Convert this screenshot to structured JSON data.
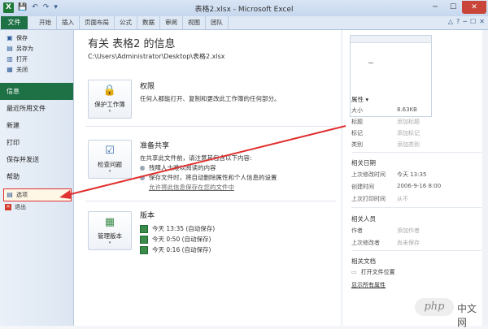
{
  "titlebar": {
    "title": "表格2.xlsx - Microsoft Excel",
    "app_glyph": "X",
    "qat": [
      "💾",
      "↶",
      "↷",
      "▾"
    ],
    "controls": [
      "─",
      "☐",
      "✕"
    ]
  },
  "ribbon": {
    "file_tab": "文件",
    "tabs": [
      "开始",
      "插入",
      "页面布局",
      "公式",
      "数据",
      "审阅",
      "视图",
      "团队"
    ],
    "right_icons": [
      "△",
      "?",
      "─",
      "☐",
      "✕"
    ]
  },
  "nav": {
    "small": [
      {
        "label": "保存",
        "icon": "save-icon",
        "glyph": "▣"
      },
      {
        "label": "另存为",
        "icon": "save-as-icon",
        "glyph": "▤"
      },
      {
        "label": "打开",
        "icon": "folder-icon",
        "glyph": "▥"
      },
      {
        "label": "关闭",
        "icon": "close-file-icon",
        "glyph": "▦"
      }
    ],
    "big": [
      "信息",
      "最近所用文件",
      "新建",
      "打印",
      "保存并发送",
      "帮助"
    ],
    "active_index": 0,
    "options": "选项",
    "exit": "退出"
  },
  "main": {
    "title": "有关 表格2 的信息",
    "path": "C:\\Users\\Administrator\\Desktop\\表格2.xlsx",
    "permissions": {
      "button": "保护工作簿",
      "title": "权限",
      "desc": "任何人都能打开、复制和更改此工作簿的任何部分。"
    },
    "share": {
      "button": "检查问题",
      "title": "准备共享",
      "desc": "在共享此文件前，请注意其包含以下内容:",
      "bullets": [
        "残障人士难以阅读的内容",
        "保存文件时，将自动删除属性和个人信息的设置"
      ],
      "link": "允许将此信息保存在您的文件中"
    },
    "versions": {
      "button": "管理版本",
      "title": "版本",
      "items": [
        "今天 13:35 (自动保存)",
        "今天 0:50 (自动保存)",
        "今天 0:16 (自动保存)"
      ]
    }
  },
  "properties": {
    "header": "属性 ▾",
    "rows": [
      {
        "key": "大小",
        "value": "8.63KB",
        "muted": false
      },
      {
        "key": "标题",
        "value": "添加标题",
        "muted": true
      },
      {
        "key": "标记",
        "value": "添加标记",
        "muted": true
      },
      {
        "key": "类别",
        "value": "添加类别",
        "muted": true
      }
    ],
    "dates_header": "相关日期",
    "dates": [
      {
        "key": "上次修改时间",
        "value": "今天 13:35",
        "muted": false
      },
      {
        "key": "创建时间",
        "value": "2006-9-16 8:00",
        "muted": false
      },
      {
        "key": "上次打印时间",
        "value": "从不",
        "muted": true
      }
    ],
    "people_header": "相关人员",
    "people": [
      {
        "key": "作者",
        "value": "添加作者",
        "muted": true
      },
      {
        "key": "上次修改者",
        "value": "尚未保存",
        "muted": true
      }
    ],
    "docs_header": "相关文档",
    "open_location": "打开文件位置",
    "show_all": "显示所有属性"
  },
  "watermark": {
    "logo": "php",
    "text": "中文网"
  },
  "colors": {
    "file_tab": "#1e7145",
    "annotation": "#e03030"
  }
}
